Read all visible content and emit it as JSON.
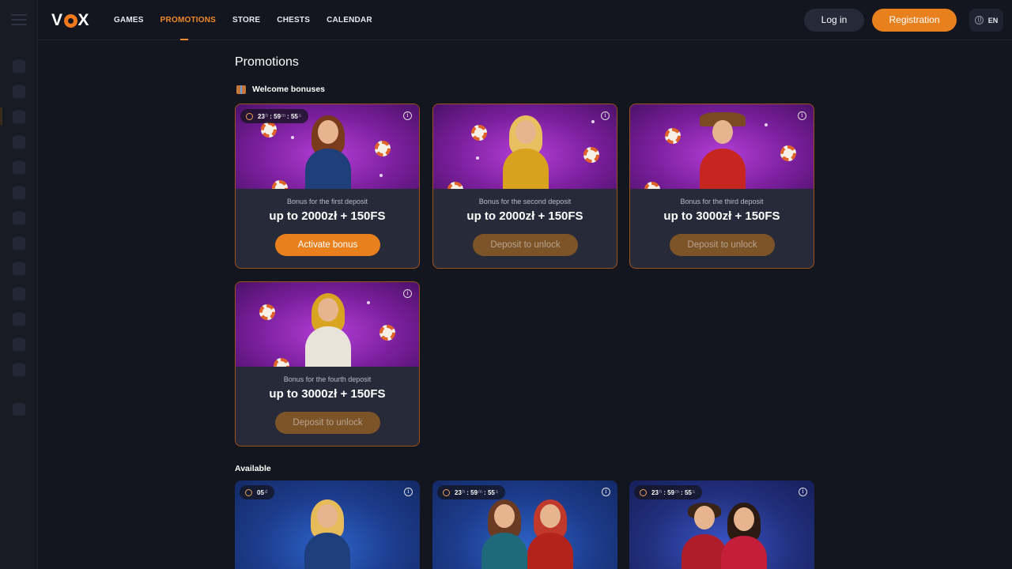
{
  "header": {
    "logo": "VOX",
    "nav": [
      "GAMES",
      "PROMOTIONS",
      "STORE",
      "CHESTS",
      "CALENDAR"
    ],
    "active_nav": "PROMOTIONS",
    "login": "Log in",
    "register": "Registration",
    "lang": "EN"
  },
  "page": {
    "title": "Promotions",
    "welcome_section": "Welcome bonuses",
    "available_section": "Available"
  },
  "welcome_cards": [
    {
      "timer": {
        "h": "23",
        "m": "59",
        "s": "55"
      },
      "subtitle": "Bonus for the first deposit",
      "amount": "up to 2000zł + 150FS",
      "button": "Activate bonus",
      "state": "active",
      "figure": "jester-woman"
    },
    {
      "subtitle": "Bonus for the second deposit",
      "amount": "up to 2000zł + 150FS",
      "button": "Deposit to unlock",
      "state": "locked",
      "figure": "princess-woman"
    },
    {
      "subtitle": "Bonus for the third deposit",
      "amount": "up to 3000zł + 150FS",
      "button": "Deposit to unlock",
      "state": "locked",
      "figure": "cowboy-man"
    },
    {
      "subtitle": "Bonus for the fourth deposit",
      "amount": "up to 3000zł + 150FS",
      "button": "Deposit to unlock",
      "state": "locked",
      "figure": "pharaoh-woman"
    }
  ],
  "available_cards": [
    {
      "timer": {
        "d": "05"
      },
      "figure": "blonde-woman-cherries"
    },
    {
      "timer": {
        "h": "23",
        "m": "59",
        "s": "55"
      },
      "figure": "two-jester-women"
    },
    {
      "timer": {
        "h": "23",
        "m": "59",
        "s": "55"
      },
      "figure": "couple-with-cash"
    }
  ],
  "units": {
    "d": "d",
    "h": "h",
    "m": "m",
    "s": "s"
  },
  "colors": {
    "accent": "#e8801e",
    "background": "#14161f",
    "card": "#262a39"
  }
}
